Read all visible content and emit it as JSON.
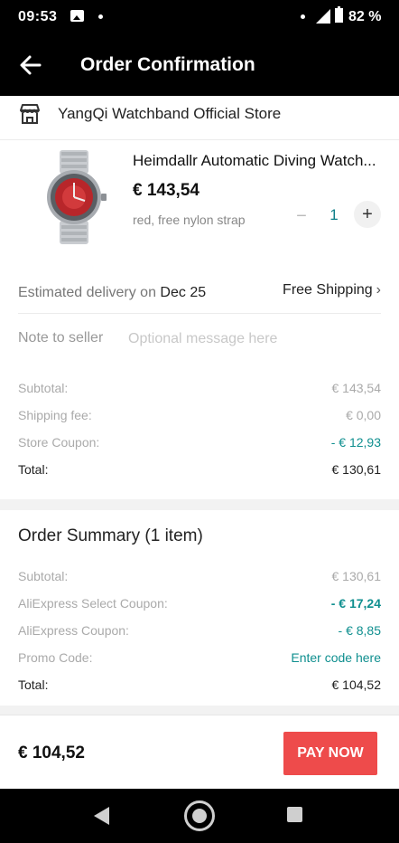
{
  "status_bar": {
    "time": "09:53",
    "battery": "82 %"
  },
  "header": {
    "title": "Order Confirmation"
  },
  "store": {
    "name": "YangQi Watchband Official Store"
  },
  "product": {
    "title": "Heimdallr Automatic Diving Watch...",
    "price": "€ 143,54",
    "variant": "red, free nylon strap",
    "quantity": "1",
    "qty_minus": "−",
    "qty_plus": "+"
  },
  "delivery": {
    "label": "Estimated delivery on",
    "date": "Dec 25",
    "shipping": "Free Shipping",
    "shipping_chevron": "›"
  },
  "note": {
    "label": "Note to seller",
    "placeholder": "Optional message here",
    "value": ""
  },
  "store_summary": [
    {
      "label": "Subtotal:",
      "value": "€ 143,54"
    },
    {
      "label": "Shipping fee:",
      "value": "€ 0,00"
    },
    {
      "label": "Store Coupon:",
      "value": "- € 12,93"
    },
    {
      "label": "Total:",
      "value": "€ 130,61"
    }
  ],
  "order_summary": {
    "title": "Order Summary (1 item)",
    "rows": [
      {
        "label": "Subtotal:",
        "value": "€ 130,61"
      },
      {
        "label": "AliExpress Select Coupon:",
        "value": "- € 17,24"
      },
      {
        "label": "AliExpress Coupon:",
        "value": "- € 8,85"
      },
      {
        "label": "Promo Code:",
        "value": "Enter code here"
      },
      {
        "label": "Total:",
        "value": "€ 104,52"
      }
    ]
  },
  "bottom_bar": {
    "total": "€ 104,52",
    "pay_label": "PAY NOW"
  },
  "colors": {
    "header_bg": "#000000",
    "accent_teal": "#0f8f8f",
    "pay_button": "#ee4b4b"
  },
  "icons": [
    "arrow-left-icon",
    "store-icon",
    "chevron-right-icon",
    "nav-back-icon",
    "nav-home-icon",
    "nav-recents-icon"
  ]
}
